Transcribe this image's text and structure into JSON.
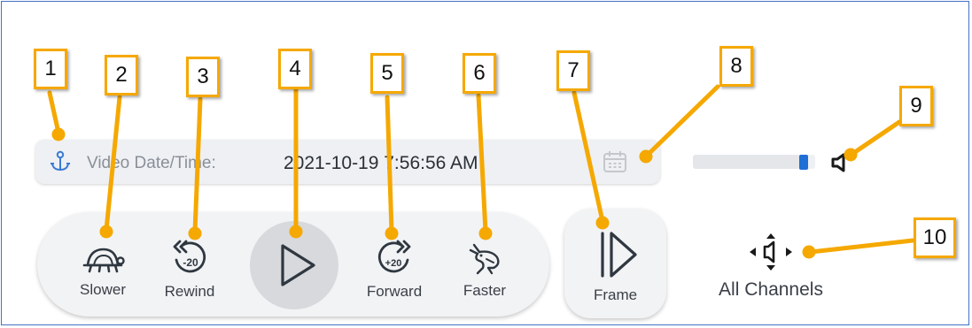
{
  "datetime": {
    "label": "Video Date/Time:",
    "value": "2021-10-19 7:56:56 AM",
    "anchor_icon": "anchor-icon",
    "calendar_icon": "calendar-icon"
  },
  "volume": {
    "level": 0.94,
    "icon": "speaker-icon"
  },
  "controls": {
    "slower": "Slower",
    "rewind": "Rewind",
    "rewind_seconds": "-20",
    "forward": "Forward",
    "forward_seconds": "+20",
    "faster": "Faster",
    "frame": "Frame"
  },
  "channels": {
    "label": "All Channels"
  },
  "callouts": [
    "1",
    "2",
    "3",
    "4",
    "5",
    "6",
    "7",
    "8",
    "9",
    "10"
  ],
  "colors": {
    "callout_border": "#f5a800",
    "accent": "#1f6fd6",
    "icon": "#2f3740"
  }
}
